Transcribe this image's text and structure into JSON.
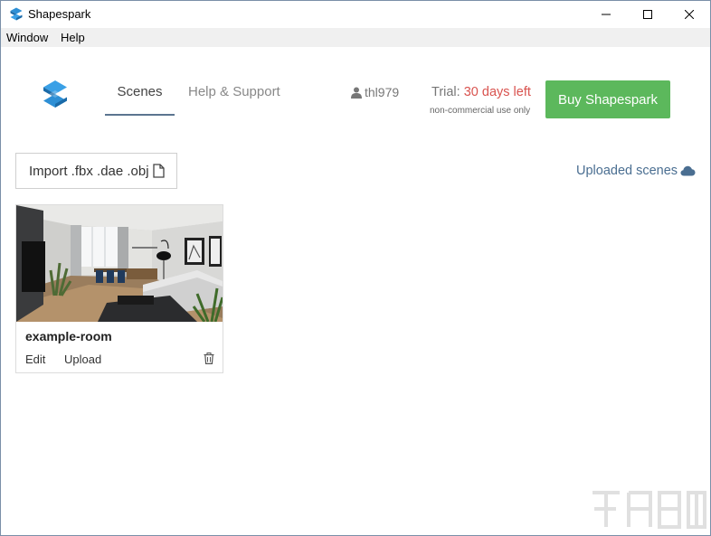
{
  "window": {
    "title": "Shapespark",
    "controls": {
      "minimize_icon": "minimize-icon",
      "maximize_icon": "maximize-icon",
      "close_icon": "close-icon"
    }
  },
  "menu": {
    "items": [
      {
        "label": "Window"
      },
      {
        "label": "Help"
      }
    ]
  },
  "header": {
    "logo_icon": "shapespark-logo-icon",
    "tabs": [
      {
        "label": "Scenes",
        "active": true
      },
      {
        "label": "Help & Support",
        "active": false
      }
    ],
    "user": {
      "icon": "user-icon",
      "name": "thl979"
    },
    "trial": {
      "prefix": "Trial: ",
      "days": "30 days left",
      "note": "non-commercial use only"
    },
    "buy_label": "Buy Shapespark"
  },
  "toolbar": {
    "import_label": "Import .fbx .dae .obj",
    "import_icon": "file-icon",
    "uploaded_label": "Uploaded scenes",
    "uploaded_icon": "cloud-icon"
  },
  "scenes": [
    {
      "name": "example-room",
      "edit_label": "Edit",
      "upload_label": "Upload",
      "delete_icon": "trash-icon"
    }
  ],
  "colors": {
    "accent": "#5b7590",
    "buy_button": "#5cb85c",
    "trial_days": "#d9534f",
    "link": "#4a6e91",
    "logo": "#2d8fd5"
  }
}
